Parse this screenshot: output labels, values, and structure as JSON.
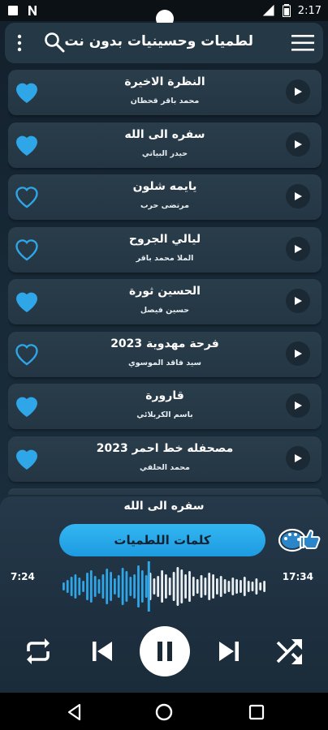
{
  "status_bar": {
    "time": "2:17",
    "left_icons": [
      "app-square-icon",
      "n-notification-icon"
    ],
    "right_icons": [
      "signal-icon",
      "battery-icon"
    ]
  },
  "app_bar": {
    "title": "لطميات وحسينيات بدون نت",
    "menu_icon": "hamburger-menu-icon",
    "search_icon": "search-icon",
    "more_icon": "more-vertical-icon"
  },
  "colors": {
    "accent": "#2fa6e8",
    "card": "#263a47",
    "background": "#16242f",
    "heart_filled": "#2fa6e8"
  },
  "songs": [
    {
      "title": "النظرة الاخيرة",
      "artist": "محمد باقر قحطان",
      "favorite": true
    },
    {
      "title": "سفره الى الله",
      "artist": "حيدر البياتي",
      "favorite": true
    },
    {
      "title": "يايمه شلون",
      "artist": "مرتضى حرب",
      "favorite": false
    },
    {
      "title": "ليالي الجروح",
      "artist": "الملا محمد باقر",
      "favorite": false
    },
    {
      "title": "الحسين ثورة",
      "artist": "حسين فيصل",
      "favorite": true
    },
    {
      "title": "فرحة مهدوية 2023",
      "artist": "سيد فاقد الموسوي",
      "favorite": false
    },
    {
      "title": "قارورة",
      "artist": "باسم الكربلائي",
      "favorite": true
    },
    {
      "title": "مصحفله خط احمر 2023",
      "artist": "محمد الحلفي",
      "favorite": true
    }
  ],
  "player": {
    "now_playing": "سفره الى الله",
    "lyrics_button": "كلمات اللطميات",
    "elapsed": "7:24",
    "duration": "17:34",
    "progress": 0.42,
    "theme_icon": "palette-thumbs-up-icon",
    "controls": [
      "repeat-icon",
      "skip-previous-icon",
      "pause-icon",
      "skip-next-icon",
      "shuffle-icon"
    ]
  },
  "nav_bar": {
    "icons": [
      "back-triangle-icon",
      "home-circle-icon",
      "recents-square-icon"
    ]
  }
}
